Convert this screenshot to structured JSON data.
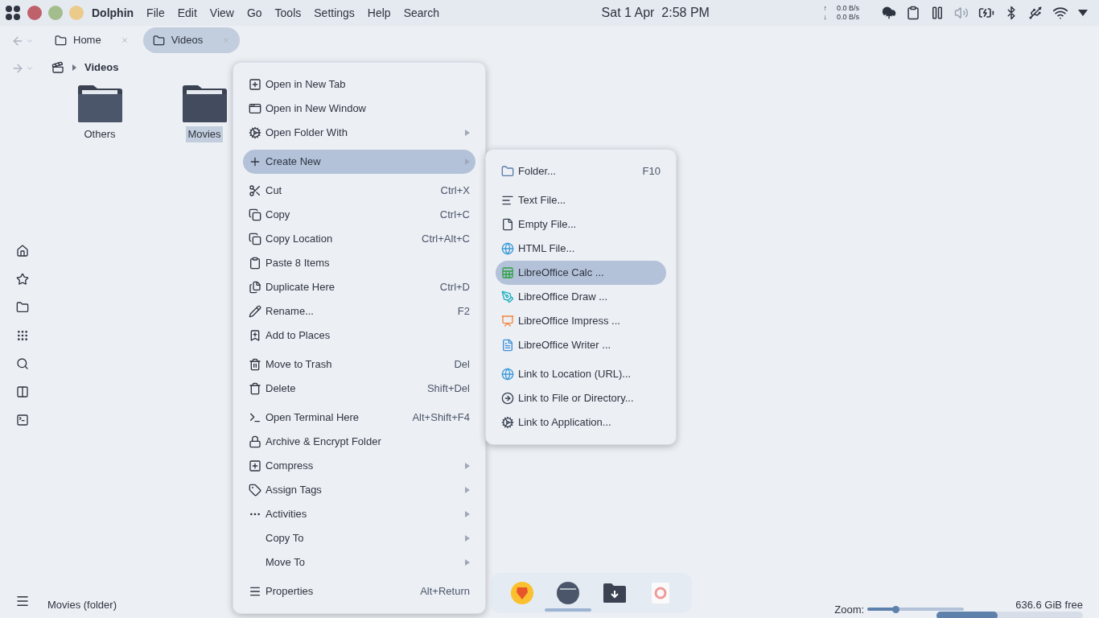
{
  "top_bar": {
    "app_name": "Dolphin",
    "menus": [
      "File",
      "Edit",
      "View",
      "Go",
      "Tools",
      "Settings",
      "Help",
      "Search"
    ],
    "clock": "Sat 1 Apr  2:58 PM",
    "net": [
      {
        "arrow": "↑",
        "rate": "0.0 B/s"
      },
      {
        "arrow": "↓",
        "rate": "0.0 B/s"
      }
    ]
  },
  "tabs": [
    {
      "label": "Home",
      "selected": false
    },
    {
      "label": "Videos",
      "selected": true
    }
  ],
  "breadcrumb": {
    "current": "Videos"
  },
  "files": [
    {
      "name": "Others",
      "selected": false
    },
    {
      "name": "Movies",
      "selected": true
    }
  ],
  "context_menu": [
    {
      "kind": "item",
      "label": "Open in New Tab",
      "selected": false
    },
    {
      "kind": "item",
      "label": "Open in New Window",
      "selected": false
    },
    {
      "kind": "item",
      "label": "Open Folder With",
      "submenu": true,
      "selected": false
    },
    {
      "kind": "separator"
    },
    {
      "kind": "item",
      "label": "Create New",
      "submenu": true,
      "selected": true
    },
    {
      "kind": "separator"
    },
    {
      "kind": "item",
      "label": "Cut",
      "shortcut": "Ctrl+X",
      "selected": false
    },
    {
      "kind": "item",
      "label": "Copy",
      "shortcut": "Ctrl+C",
      "selected": false
    },
    {
      "kind": "item",
      "label": "Copy Location",
      "shortcut": "Ctrl+Alt+C",
      "selected": false
    },
    {
      "kind": "item",
      "label": "Paste 8 Items",
      "selected": false
    },
    {
      "kind": "item",
      "label": "Duplicate Here",
      "shortcut": "Ctrl+D",
      "selected": false
    },
    {
      "kind": "item",
      "label": "Rename...",
      "shortcut": "F2",
      "selected": false
    },
    {
      "kind": "item",
      "label": "Add to Places",
      "selected": false
    },
    {
      "kind": "separator"
    },
    {
      "kind": "item",
      "label": "Move to Trash",
      "shortcut": "Del",
      "selected": false
    },
    {
      "kind": "item",
      "label": "Delete",
      "shortcut": "Shift+Del",
      "selected": false
    },
    {
      "kind": "separator"
    },
    {
      "kind": "item",
      "label": "Open Terminal Here",
      "shortcut": "Alt+Shift+F4",
      "selected": false
    },
    {
      "kind": "item",
      "label": "Archive & Encrypt Folder",
      "selected": false
    },
    {
      "kind": "item",
      "label": "Compress",
      "submenu": true,
      "selected": false
    },
    {
      "kind": "item",
      "label": "Assign Tags",
      "submenu": true,
      "selected": false
    },
    {
      "kind": "item",
      "label": "Activities",
      "submenu": true,
      "selected": false
    },
    {
      "kind": "item",
      "label": "Copy To",
      "submenu": true,
      "selected": false
    },
    {
      "kind": "item",
      "label": "Move To",
      "submenu": true,
      "selected": false
    },
    {
      "kind": "separator"
    },
    {
      "kind": "item",
      "label": "Properties",
      "shortcut": "Alt+Return",
      "selected": false
    }
  ],
  "submenu": [
    {
      "kind": "item",
      "label": "Folder...",
      "shortcut": "F10",
      "selected": false
    },
    {
      "kind": "separator"
    },
    {
      "kind": "item",
      "label": "Text File...",
      "selected": false
    },
    {
      "kind": "item",
      "label": "Empty File...",
      "selected": false
    },
    {
      "kind": "item",
      "label": "HTML File...",
      "selected": false
    },
    {
      "kind": "item",
      "label": "LibreOffice Calc  ...",
      "selected": true
    },
    {
      "kind": "item",
      "label": "LibreOffice Draw  ...",
      "selected": false
    },
    {
      "kind": "item",
      "label": "LibreOffice Impress  ...",
      "selected": false
    },
    {
      "kind": "item",
      "label": "LibreOffice Writer  ...",
      "selected": false
    },
    {
      "kind": "separator"
    },
    {
      "kind": "item",
      "label": "Link to Location (URL)...",
      "selected": false
    },
    {
      "kind": "item",
      "label": "Link to File or Directory...",
      "selected": false
    },
    {
      "kind": "item",
      "label": "Link to Application...",
      "selected": false
    }
  ],
  "status_bar": {
    "text": "Movies (folder)",
    "zoom_label": "Zoom:",
    "zoom": {
      "level": 0.29
    },
    "free_space": "636.6 GiB free",
    "usage": {
      "level": 0.42
    }
  },
  "dock": [
    {
      "active": false
    },
    {
      "active": true
    },
    {
      "active": false
    },
    {
      "active": false
    }
  ]
}
